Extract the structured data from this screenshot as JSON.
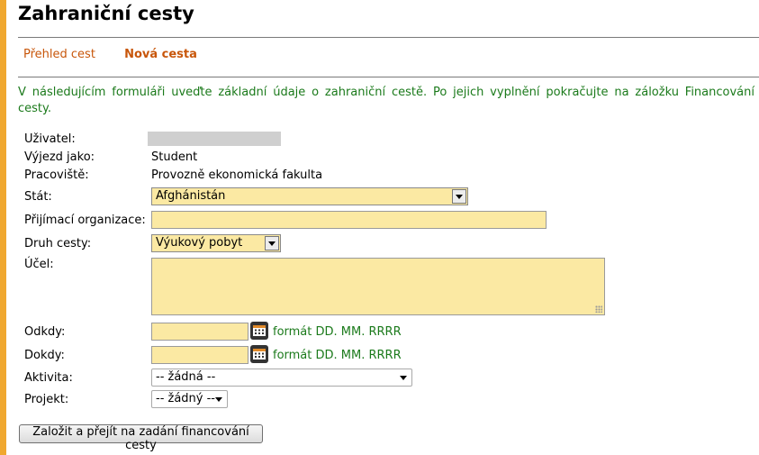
{
  "page_title": "Zahraniční cesty",
  "tabs": [
    {
      "label": "Přehled cest",
      "active": false
    },
    {
      "label": "Nová cesta",
      "active": true
    }
  ],
  "intro": "V následujícím formuláři uveďte základní údaje o zahraniční cestě. Po jejich vyplnění pokračujte na záložku Financování cesty.",
  "form": {
    "user_label": "Uživatel:",
    "trip_as_label": "Výjezd jako:",
    "trip_as_value": "Student",
    "workplace_label": "Pracoviště:",
    "workplace_value": "Provozně ekonomická fakulta",
    "country_label": "Stát:",
    "country_value": "Afghánistán",
    "receiving_org_label": "Přijímací organizace:",
    "receiving_org_value": "",
    "trip_type_label": "Druh cesty:",
    "trip_type_value": "Výukový pobyt",
    "purpose_label": "Účel:",
    "purpose_value": "",
    "from_label": "Odkdy:",
    "to_label": "Dokdy:",
    "date_format_hint": "formát DD. MM. RRRR",
    "activity_label": "Aktivita:",
    "activity_value": "-- žádná --",
    "project_label": "Projekt:",
    "project_value": "-- žádný --"
  },
  "submit_label": "Založit a přejít na zadání financování cesty",
  "colors": {
    "accent_bar": "#f0a830",
    "tab_link": "#c8560a",
    "intro_text": "#1b7a1b",
    "field_bg": "#fbe9a3"
  },
  "icons": {
    "calendar": "calendar-icon",
    "dropdown": "chevron-down-icon"
  }
}
